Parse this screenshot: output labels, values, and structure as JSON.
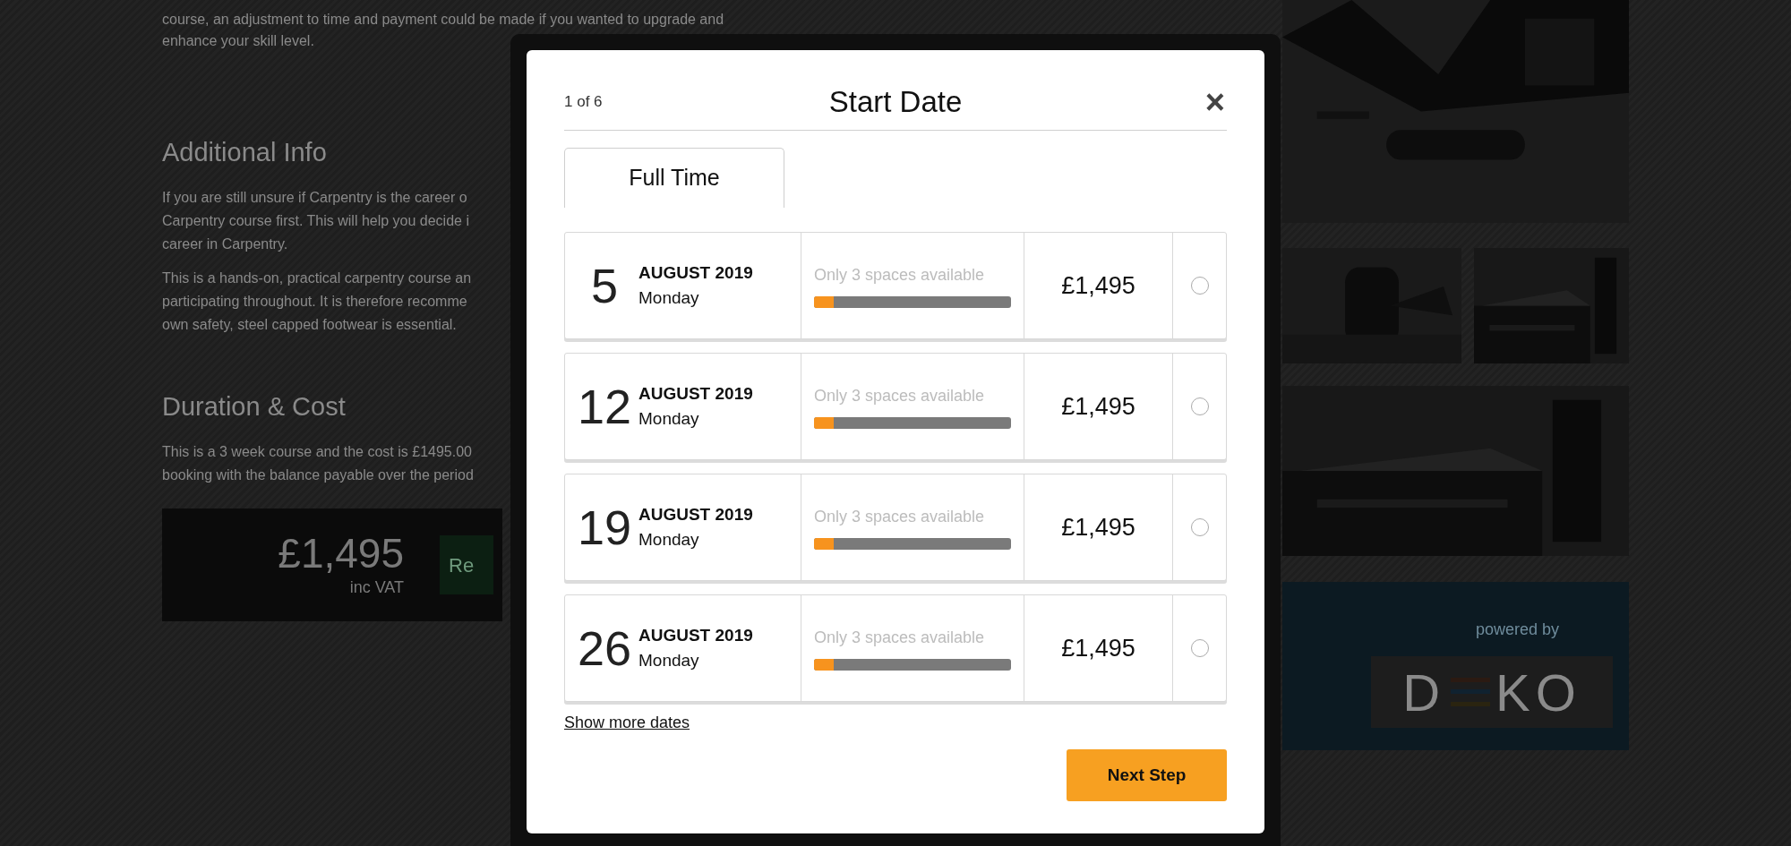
{
  "background": {
    "intro_lines": [
      "course, an adjustment to time and payment could be made if you wanted to upgrade and",
      "enhance your skill level."
    ],
    "sections": [
      {
        "heading": "Additional Info",
        "paragraphs": [
          [
            "If you are still unsure if Carpentry is the career o",
            "Carpentry course first. This will help you decide i",
            "career in Carpentry."
          ],
          [
            "This is a hands-on, practical carpentry course an",
            "participating throughout. It is therefore recomme",
            "own safety, steel capped footwear is essential."
          ]
        ]
      },
      {
        "heading": "Duration & Cost",
        "paragraphs": [
          [
            "This is a 3 week course and the cost is £1495.00",
            "booking with the balance payable over the period"
          ]
        ]
      }
    ],
    "price_box": {
      "price": "£1,495",
      "note": "inc VAT",
      "button": "Re"
    },
    "powered": {
      "label": "powered by",
      "logo_left": "D",
      "logo_right": "KO"
    }
  },
  "modal": {
    "step": "1 of 6",
    "title": "Start Date",
    "close": "×",
    "tabs": [
      {
        "label": "Full Time",
        "selected": true
      }
    ],
    "dates": [
      {
        "day": "5",
        "month": "AUGUST 2019",
        "weekday": "Monday",
        "availability": "Only 3 spaces available",
        "level": 0.1,
        "price": "£1,495",
        "selected": false
      },
      {
        "day": "12",
        "month": "AUGUST 2019",
        "weekday": "Monday",
        "availability": "Only 3 spaces available",
        "level": 0.1,
        "price": "£1,495",
        "selected": false
      },
      {
        "day": "19",
        "month": "AUGUST 2019",
        "weekday": "Monday",
        "availability": "Only 3 spaces available",
        "level": 0.1,
        "price": "£1,495",
        "selected": false
      },
      {
        "day": "26",
        "month": "AUGUST 2019",
        "weekday": "Monday",
        "availability": "Only 3 spaces available",
        "level": 0.1,
        "price": "£1,495",
        "selected": false
      }
    ],
    "more_link": "Show more dates",
    "next_button": "Next Step"
  }
}
